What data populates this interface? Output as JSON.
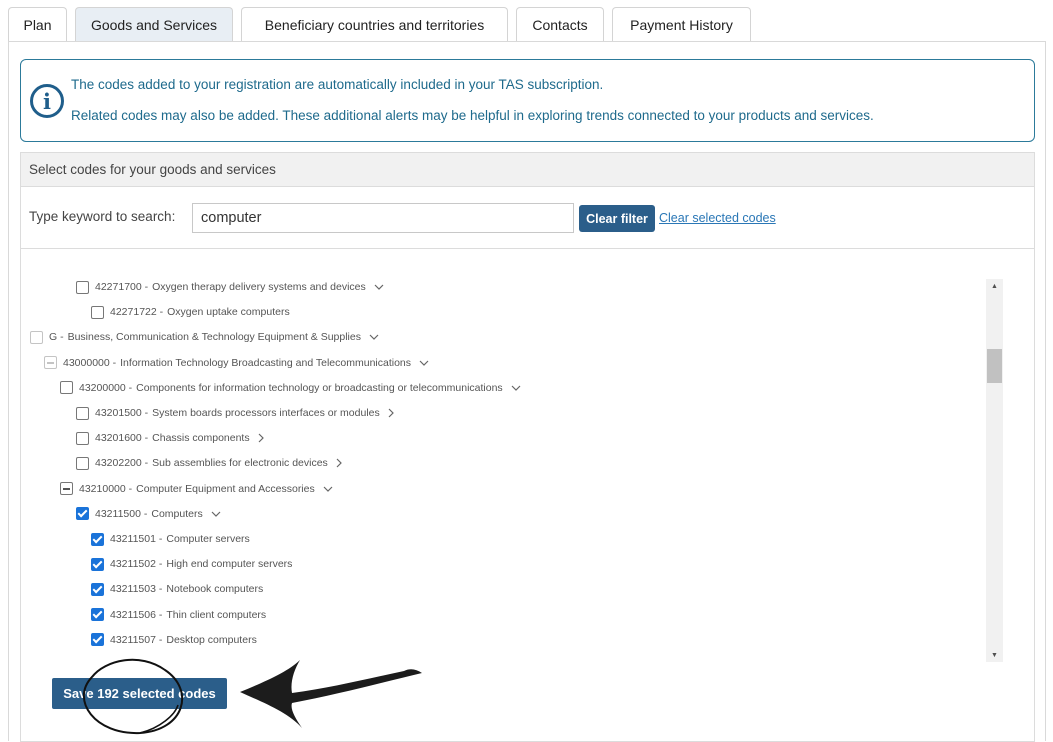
{
  "tabs": [
    {
      "label": "Plan",
      "active": false
    },
    {
      "label": "Goods and Services",
      "active": true
    },
    {
      "label": "Beneficiary countries and territories",
      "active": false
    },
    {
      "label": "Contacts",
      "active": false
    },
    {
      "label": "Payment History",
      "active": false
    }
  ],
  "info": {
    "icon": "info-circle-icon",
    "line1": "The codes added to your registration are automatically included in your TAS subscription.",
    "line2": "Related codes may also be added. These additional alerts may be helpful in exploring trends connected to your products and services."
  },
  "select_section": {
    "header": "Select codes for your goods and services",
    "search_label": "Type keyword to search:",
    "search_value": "computer",
    "clear_filter_label": "Clear filter",
    "clear_selected_label": "Clear selected codes"
  },
  "tree": [
    {
      "code": "42271700 -",
      "label": "Oxygen therapy delivery systems and devices",
      "state": "unchecked",
      "chevron": "down",
      "depth": 3
    },
    {
      "code": "42271722 -",
      "label": "Oxygen uptake computers",
      "state": "unchecked",
      "chevron": "",
      "depth": 4
    },
    {
      "code": "G -",
      "label": "Business, Communication & Technology Equipment & Supplies",
      "state": "disabled",
      "chevron": "down",
      "depth": 0
    },
    {
      "code": "43000000 -",
      "label": "Information Technology Broadcasting and Telecommunications",
      "state": "partial-disabled",
      "chevron": "down",
      "depth": 1
    },
    {
      "code": "43200000 -",
      "label": "Components for information technology or broadcasting or telecommunications",
      "state": "unchecked",
      "chevron": "down",
      "depth": 2
    },
    {
      "code": "43201500 -",
      "label": "System boards processors interfaces or modules",
      "state": "unchecked",
      "chevron": "right",
      "depth": 3
    },
    {
      "code": "43201600 -",
      "label": "Chassis components",
      "state": "unchecked",
      "chevron": "right",
      "depth": 3
    },
    {
      "code": "43202200 -",
      "label": "Sub assemblies for electronic devices",
      "state": "unchecked",
      "chevron": "right",
      "depth": 3
    },
    {
      "code": "43210000 -",
      "label": "Computer Equipment and Accessories",
      "state": "partial",
      "chevron": "down",
      "depth": 2
    },
    {
      "code": "43211500 -",
      "label": "Computers",
      "state": "checked",
      "chevron": "down",
      "depth": 3
    },
    {
      "code": "43211501 -",
      "label": "Computer servers",
      "state": "checked",
      "chevron": "",
      "depth": 4
    },
    {
      "code": "43211502 -",
      "label": "High end computer servers",
      "state": "checked",
      "chevron": "",
      "depth": 4
    },
    {
      "code": "43211503 -",
      "label": "Notebook computers",
      "state": "checked",
      "chevron": "",
      "depth": 4
    },
    {
      "code": "43211506 -",
      "label": "Thin client computers",
      "state": "checked",
      "chevron": "",
      "depth": 4
    },
    {
      "code": "43211507 -",
      "label": "Desktop computers",
      "state": "checked",
      "chevron": "",
      "depth": 4
    }
  ],
  "save_button_label": "Save 192 selected codes",
  "colors": {
    "accent": "#2b5e8a",
    "info_border": "#2c7a9a",
    "checkbox_checked": "#1a73d9"
  }
}
